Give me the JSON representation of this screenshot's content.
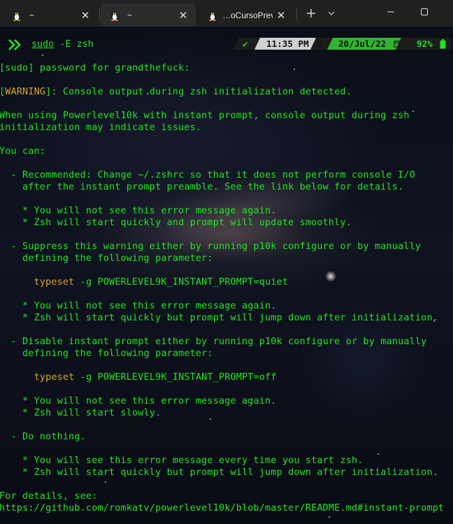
{
  "window": {
    "tabs": [
      {
        "title": "~",
        "active": false
      },
      {
        "title": "~",
        "active": true
      },
      {
        "title": "…oCursoPrev",
        "active": false
      }
    ],
    "new_tab_icon": "plus-icon",
    "dropdown_icon": "chevron-down-icon",
    "minimize_icon": "minimize-icon",
    "maximize_icon": "maximize-icon"
  },
  "prompt": {
    "sudo": "sudo",
    "args": " -E zsh",
    "status": "✔",
    "time": "11:35 PM",
    "date": "20/Jul/22",
    "battery": "92%"
  },
  "output": [
    "[sudo] password for grandthefuck:",
    "",
    "[WARNING]: Console output during zsh initialization detected.",
    "",
    "When using Powerlevel10k with instant prompt, console output during zsh",
    "initialization may indicate issues.",
    "",
    "You can:",
    "",
    "  - Recommended: Change ~/.zshrc so that it does not perform console I/O",
    "    after the instant prompt preamble. See the link below for details.",
    "",
    "    * You will not see this error message again.",
    "    * Zsh will start quickly and prompt will update smoothly.",
    "",
    "  - Suppress this warning either by running p10k configure or by manually",
    "    defining the following parameter:",
    "",
    "      typeset -g POWERLEVEL9K_INSTANT_PROMPT=quiet",
    "",
    "    * You will not see this error message again.",
    "    * Zsh will start quickly but prompt will jump down after initialization.",
    "",
    "  - Disable instant prompt either by running p10k configure or by manually",
    "    defining the following parameter:",
    "",
    "      typeset -g POWERLEVEL9K_INSTANT_PROMPT=off",
    "",
    "    * You will not see this error message again.",
    "    * Zsh will start slowly.",
    "",
    "  - Do nothing.",
    "",
    "    * You will see this error message every time you start zsh.",
    "    * Zsh will start quickly but prompt will jump down after initialization.",
    "",
    "For details, see:",
    "https://github.com/romkatv/powerlevel10k/blob/master/README.md#instant-prompt"
  ],
  "colors": {
    "terminal_green": "#22e522",
    "keyword_yellow": "#d9a72c",
    "segment_dark": "#1c1c1c",
    "segment_light": "#d0d0d0",
    "segment_green": "#2fb52f"
  }
}
